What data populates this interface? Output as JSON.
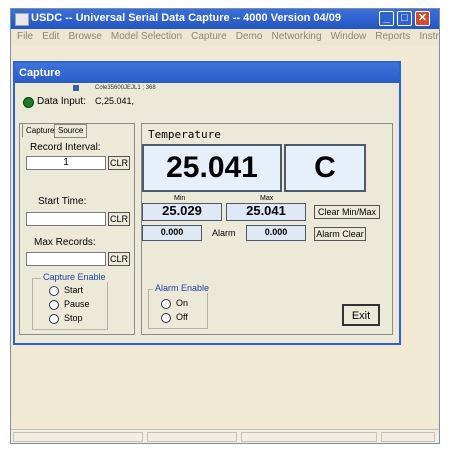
{
  "window": {
    "title": "USDC  --  Universal Serial Data Capture  --  4000   Version 04/09",
    "minimize_glyph": "_",
    "maximize_glyph": "□",
    "close_glyph": "✕"
  },
  "menu": [
    "File",
    "Edit",
    "Browse",
    "Model Selection",
    "Capture",
    "Demo",
    "Networking",
    "Window",
    "Reports",
    "Instructions/Help"
  ],
  "dialog": {
    "title": "Capture",
    "device_info": "Cole35600JEJL1 ; 368",
    "data_input_label": "Data Input:",
    "data_input_value": "C,25.041,",
    "status_led_color": "#1f7a2a"
  },
  "left_panel": {
    "tabs": [
      "Capture",
      "Source"
    ],
    "record_interval": {
      "label": "Record Interval:",
      "value": "1",
      "clear": "CLR"
    },
    "start_time": {
      "label": "Start Time:",
      "value": "",
      "clear": "CLR"
    },
    "max_records": {
      "label": "Max Records:",
      "value": "",
      "clear": "CLR"
    },
    "capture_enable": {
      "title": "Capture Enable",
      "options": [
        "Start",
        "Pause",
        "Stop"
      ]
    }
  },
  "right_panel": {
    "title": "Temperature",
    "reading": "25.041",
    "unit": "C",
    "min_label": "Min",
    "max_label": "Max",
    "min_value": "25.029",
    "max_value": "25.041",
    "clear_minmax": "Clear Min/Max",
    "alarm_low": "0.000",
    "alarm_label": "Alarm",
    "alarm_high": "0.000",
    "alarm_clear": "Alarm Clear",
    "alarm_enable": {
      "title": "Alarm Enable",
      "options": [
        "On",
        "Off"
      ]
    },
    "exit": "Exit"
  }
}
